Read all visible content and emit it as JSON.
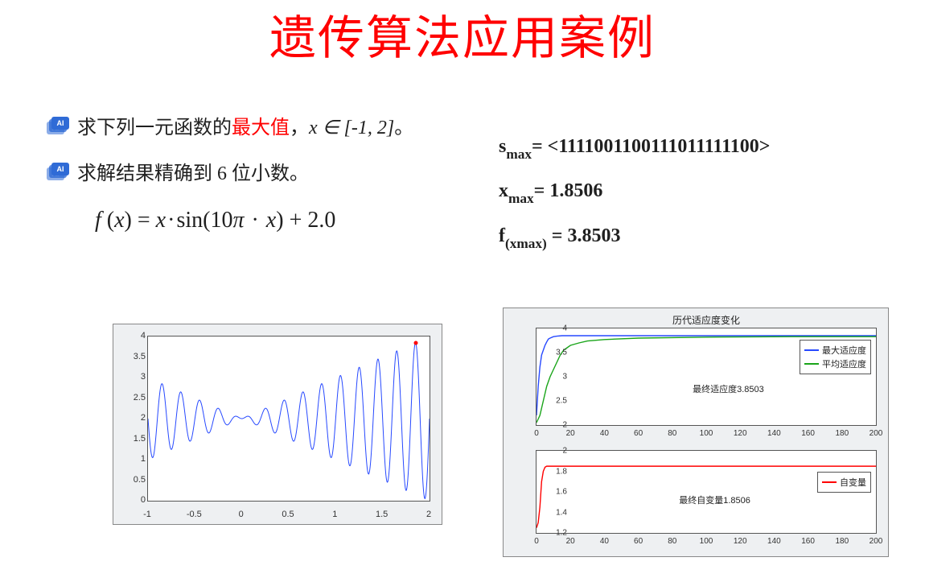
{
  "title": "遗传算法应用案例",
  "bullets": {
    "b1_prefix": "求下列一元函数的",
    "b1_highlight": "最大值",
    "b1_suffix": "，",
    "b1_math": "x ∈ [-1, 2]",
    "b1_tail": "。",
    "b2_prefix": "求解结果精确到",
    "b2_num": " 6 ",
    "b2_suffix": "位小数。"
  },
  "equation": {
    "text": "f (x) = x · sin(10π · x) + 2.0"
  },
  "results": {
    "s_label": "s",
    "s_sub": "max",
    "s_eq": "= <1111001100111011111100>",
    "x_label": "x",
    "x_sub": "max",
    "x_eq": "= 1.8506",
    "f_label": "f",
    "f_sub": "(xmax)",
    "f_eq": " = 3.8503"
  },
  "chart_data": [
    {
      "type": "line",
      "title": "",
      "xlabel": "",
      "ylabel": "",
      "xlim": [
        -1,
        2
      ],
      "ylim": [
        0,
        4
      ],
      "xticks": [
        -1,
        -0.5,
        0,
        0.5,
        1,
        1.5,
        2
      ],
      "yticks": [
        0,
        0.5,
        1,
        1.5,
        2,
        2.5,
        3,
        3.5,
        4
      ],
      "series": [
        {
          "name": "f(x)=x·sin(10πx)+2",
          "color": "#2749ff",
          "formula": "x*sin(10*pi*x)+2"
        }
      ],
      "max_point": {
        "x": 1.8506,
        "y": 3.8503,
        "color": "#ff0000"
      }
    },
    {
      "type": "line",
      "title": "历代适应度变化",
      "xlabel": "",
      "ylabel": "",
      "xlim": [
        0,
        200
      ],
      "ylim": [
        2,
        4
      ],
      "xticks": [
        0,
        20,
        40,
        60,
        80,
        100,
        120,
        140,
        160,
        180,
        200
      ],
      "yticks": [
        2,
        2.5,
        3,
        3.5,
        4
      ],
      "annotation": "最终适应度3.8503",
      "legend": [
        "最大适应度",
        "平均适应度"
      ],
      "series": [
        {
          "name": "最大适应度",
          "color": "#2749ff",
          "x": [
            0,
            1,
            2,
            3,
            4,
            5,
            6,
            7,
            8,
            10,
            12,
            15,
            200
          ],
          "y": [
            2.2,
            2.8,
            3.2,
            3.45,
            3.55,
            3.65,
            3.72,
            3.78,
            3.8,
            3.83,
            3.84,
            3.85,
            3.85
          ]
        },
        {
          "name": "平均适应度",
          "color": "#1aa51a",
          "x": [
            0,
            2,
            4,
            6,
            8,
            10,
            12,
            14,
            16,
            18,
            20,
            25,
            30,
            40,
            60,
            100,
            150,
            200
          ],
          "y": [
            2.05,
            2.2,
            2.5,
            2.8,
            3.0,
            3.15,
            3.3,
            3.45,
            3.55,
            3.6,
            3.65,
            3.7,
            3.74,
            3.77,
            3.8,
            3.82,
            3.83,
            3.83
          ]
        }
      ]
    },
    {
      "type": "line",
      "title": "",
      "xlabel": "",
      "ylabel": "",
      "xlim": [
        0,
        200
      ],
      "ylim": [
        1.2,
        2
      ],
      "xticks": [
        0,
        20,
        40,
        60,
        80,
        100,
        120,
        140,
        160,
        180,
        200
      ],
      "yticks": [
        1.2,
        1.4,
        1.6,
        1.8,
        2
      ],
      "annotation": "最终自变量1.8506",
      "legend": [
        "自变量"
      ],
      "series": [
        {
          "name": "自变量",
          "color": "#ff0000",
          "x": [
            0,
            1,
            2,
            3,
            4,
            5,
            6,
            8,
            10,
            200
          ],
          "y": [
            1.25,
            1.3,
            1.45,
            1.7,
            1.8,
            1.84,
            1.85,
            1.85,
            1.85,
            1.85
          ]
        }
      ]
    }
  ]
}
